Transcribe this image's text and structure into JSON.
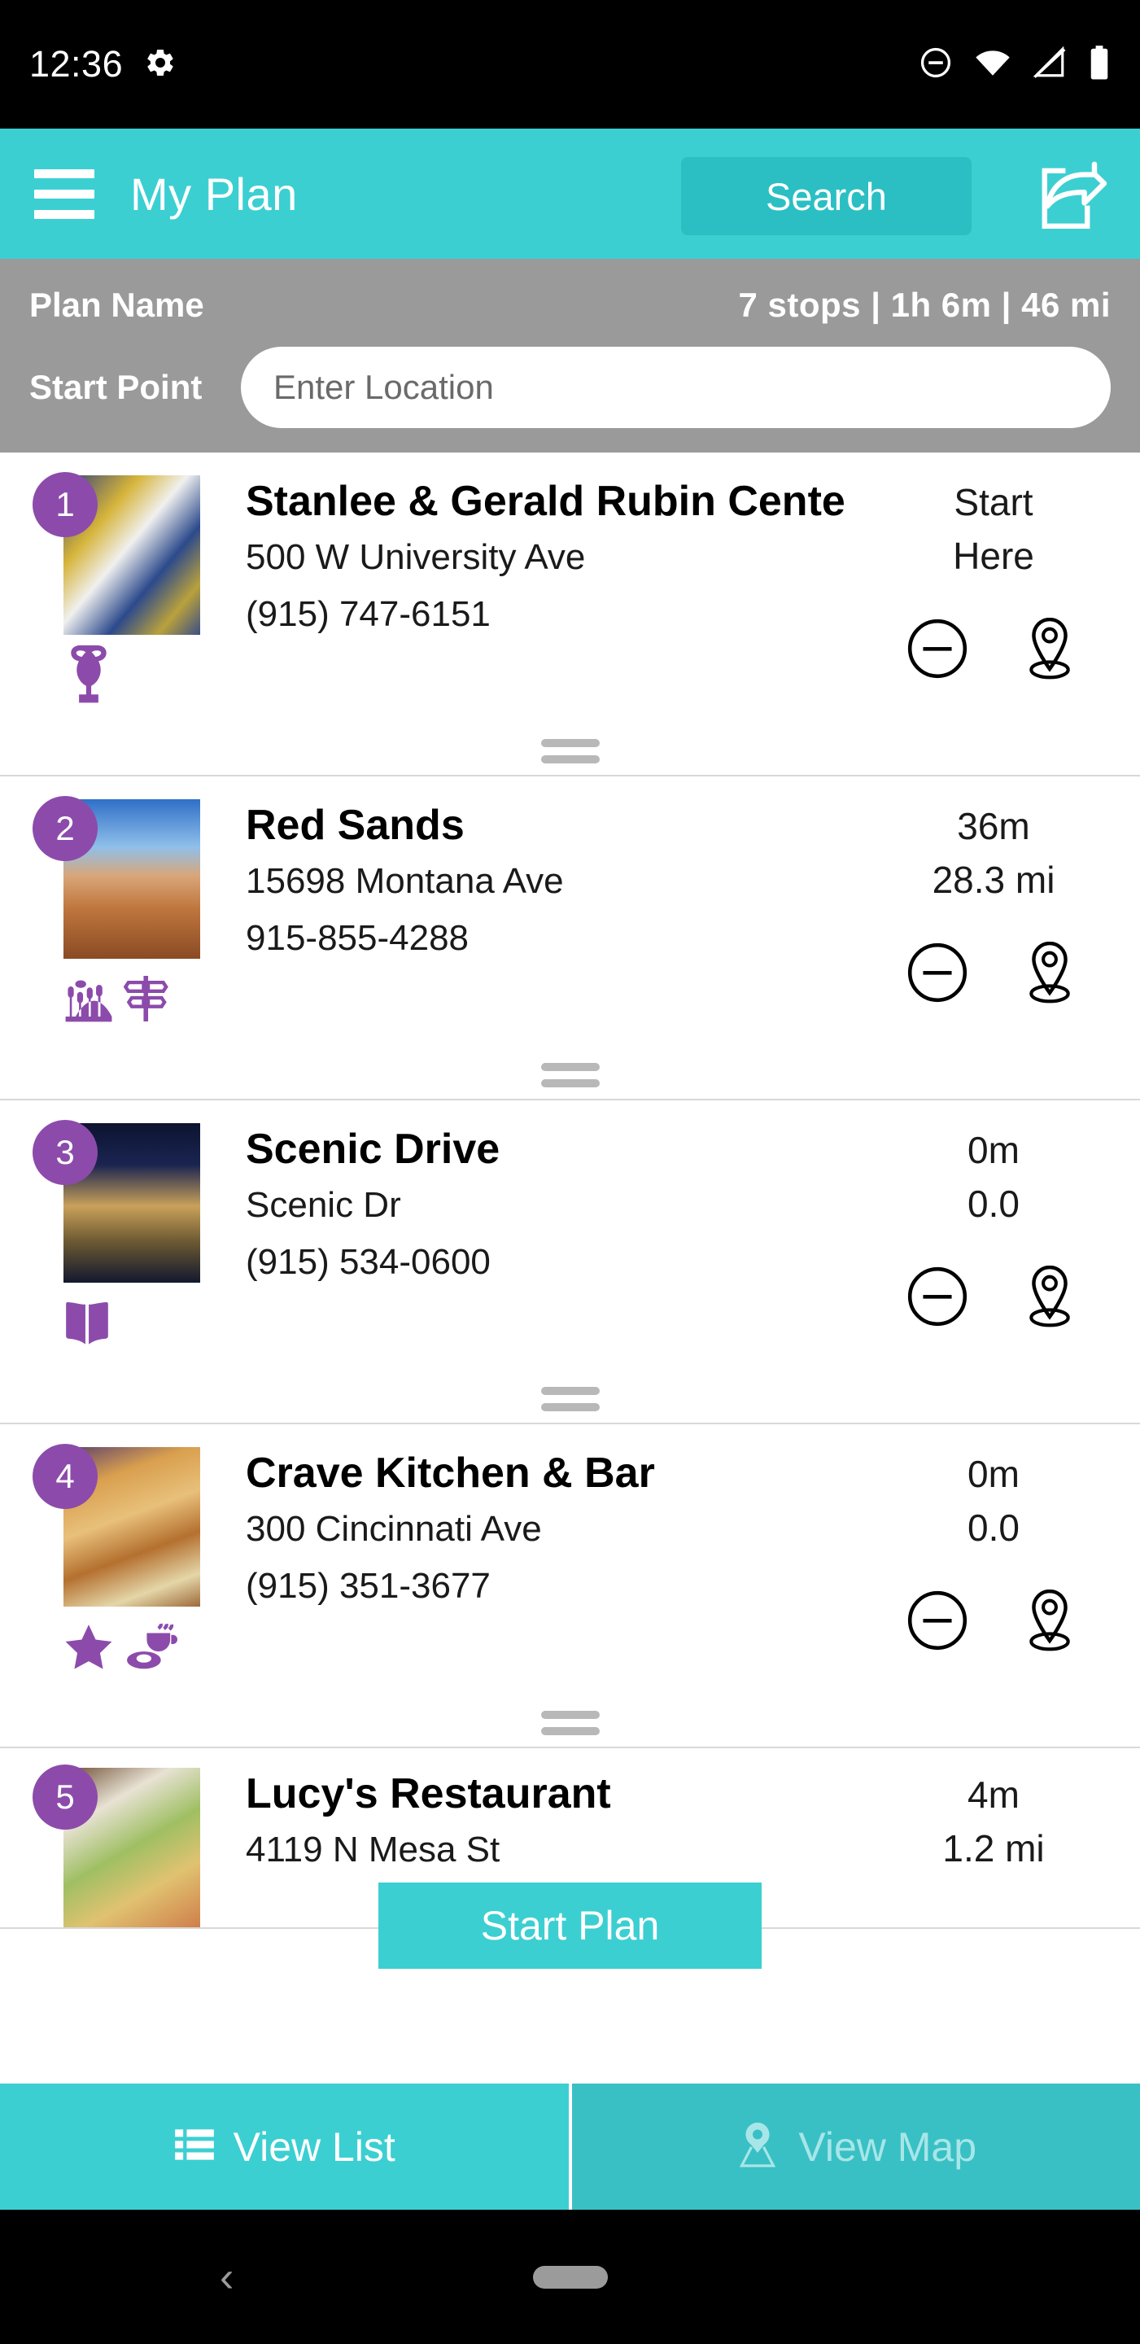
{
  "status_bar": {
    "time": "12:36",
    "left_icons": [
      "gear-icon"
    ],
    "right_icons": [
      "do-not-disturb-icon",
      "wifi-icon",
      "cell-signal-icon",
      "battery-icon"
    ]
  },
  "app_bar": {
    "menu_icon": "hamburger-menu-icon",
    "title": "My Plan",
    "search_label": "Search",
    "share_icon": "share-icon",
    "background_color": "#3ccfd2",
    "search_button_color": "#2bbfc3"
  },
  "plan_bar": {
    "plan_name_label": "Plan Name",
    "stats": "7 stops | 1h 6m | 46 mi",
    "stops_count": "7 stops",
    "duration": "1h 6m",
    "distance": "46 mi",
    "start_point_label": "Start Point",
    "start_point_value": "",
    "start_point_placeholder": "Enter Location",
    "background_color": "#9a9a9a"
  },
  "stops": [
    {
      "number": "1",
      "title": "Stanlee & Gerald Rubin Center..",
      "address": "500 W University Ave",
      "phone": "(915) 747-6151",
      "meta_line1": "Start",
      "meta_line2": "Here",
      "category_icons": [
        "museum-vase-icon"
      ]
    },
    {
      "number": "2",
      "title": "Red Sands",
      "address": "15698 Montana Ave",
      "phone": "915-855-4288",
      "meta_line1": "36m",
      "meta_line2": "28.3 mi",
      "category_icons": [
        "outdoors-park-icon",
        "signpost-icon"
      ]
    },
    {
      "number": "3",
      "title": "Scenic Drive",
      "address": "Scenic Dr",
      "phone": "(915) 534-0600",
      "meta_line1": "0m",
      "meta_line2": "0.0",
      "category_icons": [
        "open-book-icon"
      ]
    },
    {
      "number": "4",
      "title": "Crave Kitchen & Bar",
      "address": "300 Cincinnati Ave",
      "phone": "(915) 351-3677",
      "meta_line1": "0m",
      "meta_line2": "0.0",
      "category_icons": [
        "star-icon",
        "coffee-cup-icon"
      ]
    },
    {
      "number": "5",
      "title": "Lucy's Restaurant",
      "address": "4119 N Mesa St",
      "phone": "",
      "meta_line1": "4m",
      "meta_line2": "1.2 mi",
      "category_icons": []
    }
  ],
  "row_actions": {
    "remove_icon": "minus-circle-icon",
    "locate_icon": "map-pin-icon",
    "drag_handle_icon": "drag-handle-icon"
  },
  "start_plan": {
    "label": "Start Plan",
    "color": "#3ccfd2"
  },
  "bottom_tabs": [
    {
      "label": "View List",
      "icon": "list-icon",
      "active": true
    },
    {
      "label": "View Map",
      "icon": "map-pin-icon",
      "active": false
    }
  ],
  "nav_bar": {
    "back_icon": "back-chevron-icon",
    "home_icon": "home-pill-icon"
  },
  "theme": {
    "accent": "#3ccfd2",
    "badge_purple": "#8c4bab",
    "plan_gray": "#9a9a9a"
  }
}
